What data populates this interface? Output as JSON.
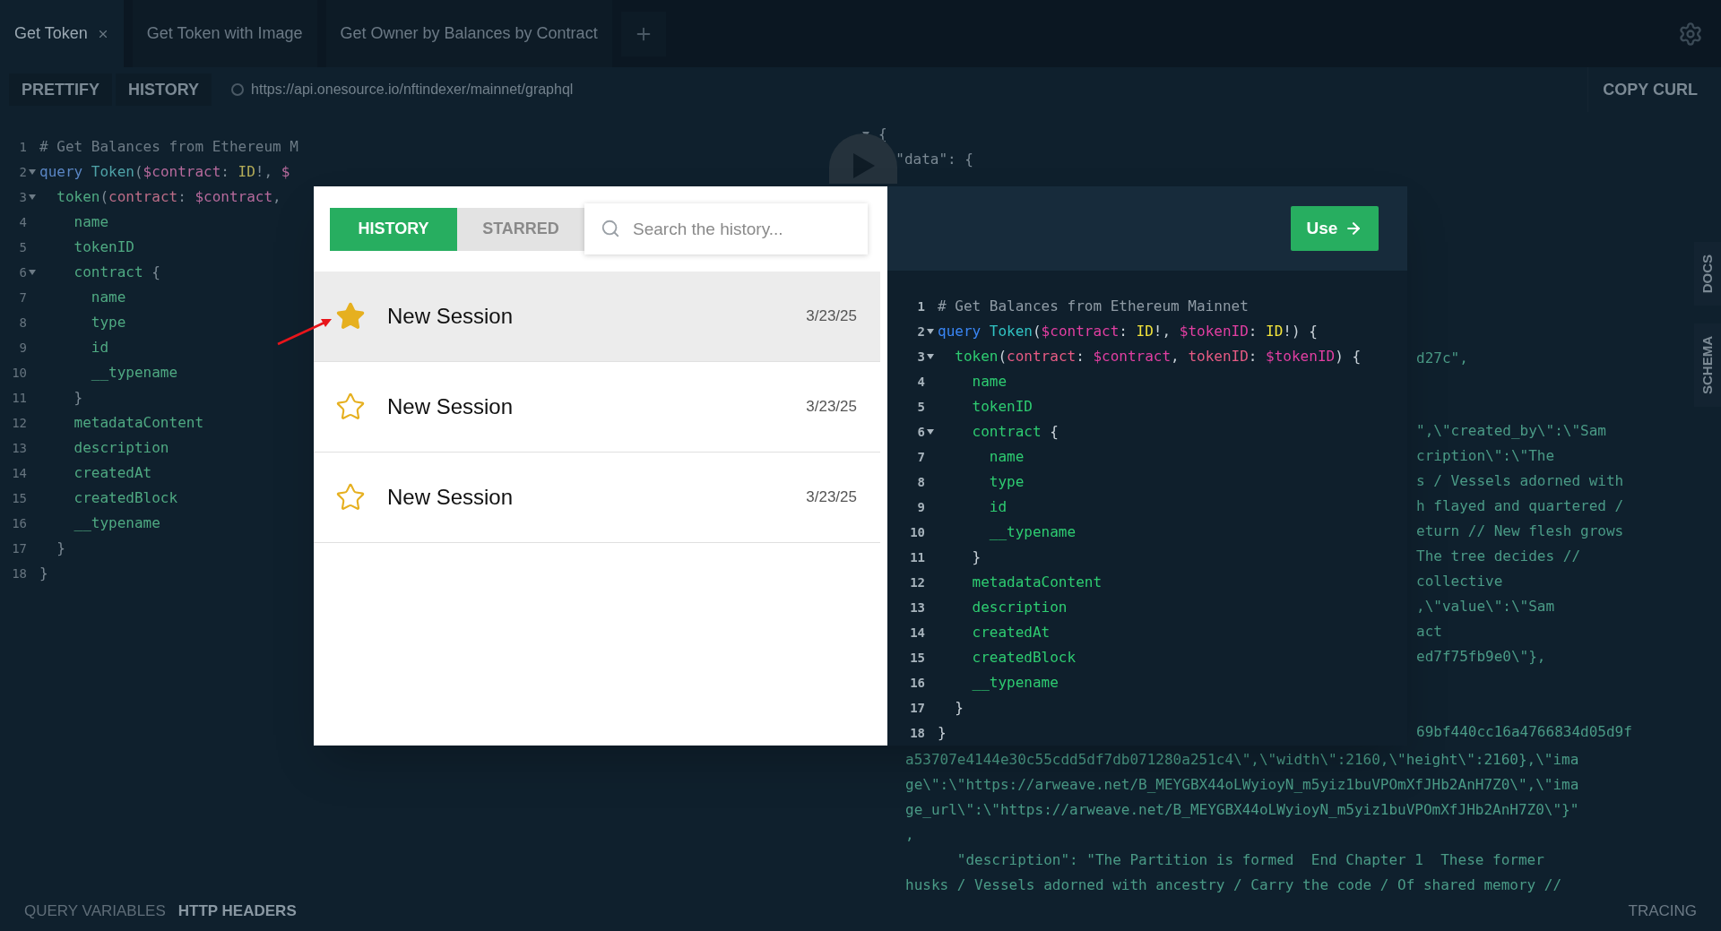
{
  "tabs": [
    {
      "label": "Get Token",
      "selected": true,
      "closable": true
    },
    {
      "label": "Get Token with Image",
      "selected": false,
      "closable": false
    },
    {
      "label": "Get Owner by Balances by Contract",
      "selected": false,
      "closable": false
    }
  ],
  "toolbar": {
    "buttons": [
      "PRETTIFY",
      "HISTORY"
    ],
    "url": "https://api.onesource.io/nftindexer/mainnet/graphql",
    "copy_curl": "COPY CURL"
  },
  "query_editor": {
    "lines": [
      {
        "number": "1",
        "foldable": false,
        "tokens": [
          {
            "kind": "comment",
            "text": "# Get Balances from Ethereum M"
          }
        ]
      },
      {
        "number": "2",
        "foldable": true,
        "tokens": [
          {
            "kind": "kw",
            "text": "query"
          },
          {
            "kind": "def",
            "text": " Token"
          },
          {
            "kind": "punct",
            "text": "("
          },
          {
            "kind": "var",
            "text": "$contract"
          },
          {
            "kind": "punct",
            "text": ": "
          },
          {
            "kind": "type",
            "text": "ID"
          },
          {
            "kind": "punct",
            "text": "!, "
          },
          {
            "kind": "var",
            "text": "$"
          }
        ]
      },
      {
        "number": "3",
        "foldable": true,
        "tokens": [
          {
            "kind": "field",
            "text": "  token"
          },
          {
            "kind": "punct",
            "text": "("
          },
          {
            "kind": "arg",
            "text": "contract"
          },
          {
            "kind": "punct",
            "text": ": "
          },
          {
            "kind": "var",
            "text": "$contract"
          },
          {
            "kind": "punct",
            "text": ","
          }
        ]
      },
      {
        "number": "4",
        "foldable": false,
        "tokens": [
          {
            "kind": "field",
            "text": "    name"
          }
        ]
      },
      {
        "number": "5",
        "foldable": false,
        "tokens": [
          {
            "kind": "field",
            "text": "    tokenID"
          }
        ]
      },
      {
        "number": "6",
        "foldable": true,
        "tokens": [
          {
            "kind": "field",
            "text": "    contract"
          },
          {
            "kind": "punct",
            "text": " {"
          }
        ]
      },
      {
        "number": "7",
        "foldable": false,
        "tokens": [
          {
            "kind": "field",
            "text": "      name"
          }
        ]
      },
      {
        "number": "8",
        "foldable": false,
        "tokens": [
          {
            "kind": "field",
            "text": "      type"
          }
        ]
      },
      {
        "number": "9",
        "foldable": false,
        "tokens": [
          {
            "kind": "field",
            "text": "      id"
          }
        ]
      },
      {
        "number": "10",
        "foldable": false,
        "tokens": [
          {
            "kind": "field",
            "text": "      __typename"
          }
        ]
      },
      {
        "number": "11",
        "foldable": false,
        "tokens": [
          {
            "kind": "punct",
            "text": "    }"
          }
        ]
      },
      {
        "number": "12",
        "foldable": false,
        "tokens": [
          {
            "kind": "field",
            "text": "    metadataContent"
          }
        ]
      },
      {
        "number": "13",
        "foldable": false,
        "tokens": [
          {
            "kind": "field",
            "text": "    description"
          }
        ]
      },
      {
        "number": "14",
        "foldable": false,
        "tokens": [
          {
            "kind": "field",
            "text": "    createdAt"
          }
        ]
      },
      {
        "number": "15",
        "foldable": false,
        "tokens": [
          {
            "kind": "field",
            "text": "    createdBlock"
          }
        ]
      },
      {
        "number": "16",
        "foldable": false,
        "tokens": [
          {
            "kind": "field",
            "text": "    __typename"
          }
        ]
      },
      {
        "number": "17",
        "foldable": false,
        "tokens": [
          {
            "kind": "punct",
            "text": "  }"
          }
        ]
      },
      {
        "number": "18",
        "foldable": false,
        "tokens": [
          {
            "kind": "punct",
            "text": "}"
          }
        ]
      }
    ]
  },
  "result": {
    "blocks": [
      {
        "kind": "head",
        "lines": [
          {
            "text": "{",
            "foldable": true
          },
          {
            "text": "  \"data\": {",
            "foldable": true
          }
        ]
      },
      {
        "kind": "side-top",
        "lines": [
          {
            "text": "d27c\",",
            "foldable": false
          }
        ]
      },
      {
        "kind": "side",
        "lines": [
          {
            "text": "\",\\\"created_by\\\":\\\"Sam",
            "foldable": false
          },
          {
            "text": "cription\\\":\\\"The",
            "foldable": false
          },
          {
            "text": "s / Vessels adorned with",
            "foldable": false
          },
          {
            "text": "h flayed and quartered /",
            "foldable": false
          },
          {
            "text": "eturn // New flesh grows",
            "foldable": false
          },
          {
            "text": "The tree decides //",
            "foldable": false
          },
          {
            "text": "collective",
            "foldable": false
          },
          {
            "text": ",\\\"value\\\":\\\"Sam",
            "foldable": false
          },
          {
            "text": "act",
            "foldable": false
          },
          {
            "text": "ed7f75fb9e0\\\"},",
            "foldable": false
          }
        ]
      },
      {
        "kind": "tail",
        "lines": [
          {
            "text": "69bf440cc16a4766834d05d9f",
            "foldable": false
          }
        ]
      },
      {
        "kind": "bottom",
        "lines": [
          {
            "text": "a53707e4144e30c55cdd5df7db071280a251c4\\\",\\\"width\\\":2160,\\\"height\\\":2160},\\\"ima",
            "foldable": false
          },
          {
            "text": "ge\\\":\\\"https://arweave.net/B_MEYGBX44oLWyioyN_m5yiz1buVPOmXfJHb2AnH7Z0\\\",\\\"ima",
            "foldable": false
          },
          {
            "text": "ge_url\\\":\\\"https://arweave.net/B_MEYGBX44oLWyioyN_m5yiz1buVPOmXfJHb2AnH7Z0\\\"}\"",
            "foldable": false
          },
          {
            "text": ",",
            "foldable": false
          },
          {
            "text": "      \"description\": \"The Partition is formed  End Chapter 1  These former",
            "foldable": false
          },
          {
            "text": "husks / Vessels adorned with ancestry / Carry the code / Of shared memory //",
            "foldable": false
          }
        ]
      }
    ]
  },
  "side_tabs": [
    "DOCS",
    "SCHEMA"
  ],
  "bottom_bar": {
    "tabs": [
      {
        "label": "QUERY VARIABLES",
        "selected": false
      },
      {
        "label": "HTTP HEADERS",
        "selected": true
      }
    ],
    "tracing": "TRACING"
  },
  "history_modal": {
    "tabs": [
      {
        "label": "HISTORY",
        "selected": true
      },
      {
        "label": "STARRED",
        "selected": false
      }
    ],
    "search": {
      "placeholder": "Search the history..."
    },
    "sessions": [
      {
        "title": "New Session",
        "date": "3/23/25",
        "starred": true,
        "selected": true
      },
      {
        "title": "New Session",
        "date": "3/23/25",
        "starred": false,
        "selected": false
      },
      {
        "title": "New Session",
        "date": "3/23/25",
        "starred": false,
        "selected": false
      }
    ],
    "use_button": "Use",
    "code": [
      {
        "number": "1",
        "foldable": false,
        "tokens": [
          {
            "kind": "comment",
            "text": "# Get Balances from Ethereum Mainnet"
          }
        ]
      },
      {
        "number": "2",
        "foldable": true,
        "tokens": [
          {
            "kind": "kw",
            "text": "query"
          },
          {
            "kind": "def",
            "text": " Token"
          },
          {
            "kind": "punct",
            "text": "("
          },
          {
            "kind": "var",
            "text": "$contract"
          },
          {
            "kind": "punct",
            "text": ": "
          },
          {
            "kind": "type",
            "text": "ID"
          },
          {
            "kind": "punct",
            "text": "!, "
          },
          {
            "kind": "var",
            "text": "$tokenID"
          },
          {
            "kind": "punct",
            "text": ": "
          },
          {
            "kind": "type",
            "text": "ID"
          },
          {
            "kind": "punct",
            "text": "!) {"
          }
        ]
      },
      {
        "number": "3",
        "foldable": true,
        "tokens": [
          {
            "kind": "field",
            "text": "  token"
          },
          {
            "kind": "punct",
            "text": "("
          },
          {
            "kind": "arg",
            "text": "contract"
          },
          {
            "kind": "punct",
            "text": ": "
          },
          {
            "kind": "var",
            "text": "$contract"
          },
          {
            "kind": "punct",
            "text": ", "
          },
          {
            "kind": "arg",
            "text": "tokenID"
          },
          {
            "kind": "punct",
            "text": ": "
          },
          {
            "kind": "var",
            "text": "$tokenID"
          },
          {
            "kind": "punct",
            "text": ") {"
          }
        ]
      },
      {
        "number": "4",
        "foldable": false,
        "tokens": [
          {
            "kind": "field",
            "text": "    name"
          }
        ]
      },
      {
        "number": "5",
        "foldable": false,
        "tokens": [
          {
            "kind": "field",
            "text": "    tokenID"
          }
        ]
      },
      {
        "number": "6",
        "foldable": true,
        "tokens": [
          {
            "kind": "field",
            "text": "    contract"
          },
          {
            "kind": "punct",
            "text": " {"
          }
        ]
      },
      {
        "number": "7",
        "foldable": false,
        "tokens": [
          {
            "kind": "field",
            "text": "      name"
          }
        ]
      },
      {
        "number": "8",
        "foldable": false,
        "tokens": [
          {
            "kind": "field",
            "text": "      type"
          }
        ]
      },
      {
        "number": "9",
        "foldable": false,
        "tokens": [
          {
            "kind": "field",
            "text": "      id"
          }
        ]
      },
      {
        "number": "10",
        "foldable": false,
        "tokens": [
          {
            "kind": "field",
            "text": "      __typename"
          }
        ]
      },
      {
        "number": "11",
        "foldable": false,
        "tokens": [
          {
            "kind": "punct",
            "text": "    }"
          }
        ]
      },
      {
        "number": "12",
        "foldable": false,
        "tokens": [
          {
            "kind": "field",
            "text": "    metadataContent"
          }
        ]
      },
      {
        "number": "13",
        "foldable": false,
        "tokens": [
          {
            "kind": "field",
            "text": "    description"
          }
        ]
      },
      {
        "number": "14",
        "foldable": false,
        "tokens": [
          {
            "kind": "field",
            "text": "    createdAt"
          }
        ]
      },
      {
        "number": "15",
        "foldable": false,
        "tokens": [
          {
            "kind": "field",
            "text": "    createdBlock"
          }
        ]
      },
      {
        "number": "16",
        "foldable": false,
        "tokens": [
          {
            "kind": "field",
            "text": "    __typename"
          }
        ]
      },
      {
        "number": "17",
        "foldable": false,
        "tokens": [
          {
            "kind": "punct",
            "text": "  }"
          }
        ]
      },
      {
        "number": "18",
        "foldable": false,
        "tokens": [
          {
            "kind": "punct",
            "text": "}"
          }
        ]
      }
    ]
  }
}
